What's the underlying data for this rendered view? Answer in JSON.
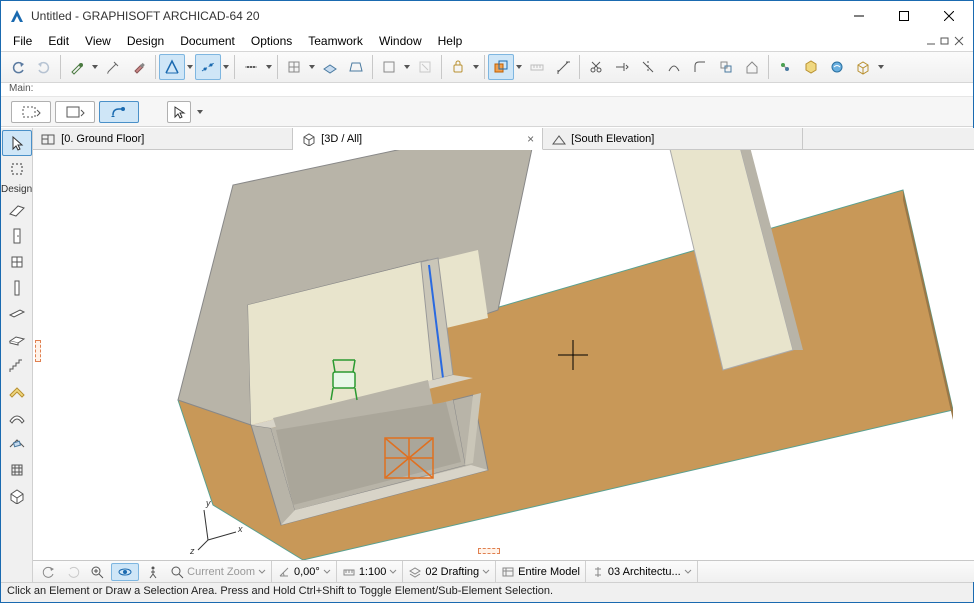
{
  "window": {
    "title": "Untitled - GRAPHISOFT ARCHICAD-64 20"
  },
  "menu": {
    "items": [
      "File",
      "Edit",
      "View",
      "Design",
      "Document",
      "Options",
      "Teamwork",
      "Window",
      "Help"
    ]
  },
  "main_label": "Main:",
  "tabs": {
    "ground": "[0. Ground Floor]",
    "threed": "[3D / All]",
    "south": "[South Elevation]"
  },
  "left_section": "Design",
  "bottom": {
    "zoom_label": "Current Zoom",
    "angle": "0,00°",
    "scale": "1:100",
    "layer": "02 Drafting",
    "model": "Entire Model",
    "dim": "03 Architectu..."
  },
  "status": "Click an Element or Draw a Selection Area. Press and Hold Ctrl+Shift to Toggle Element/Sub-Element Selection."
}
